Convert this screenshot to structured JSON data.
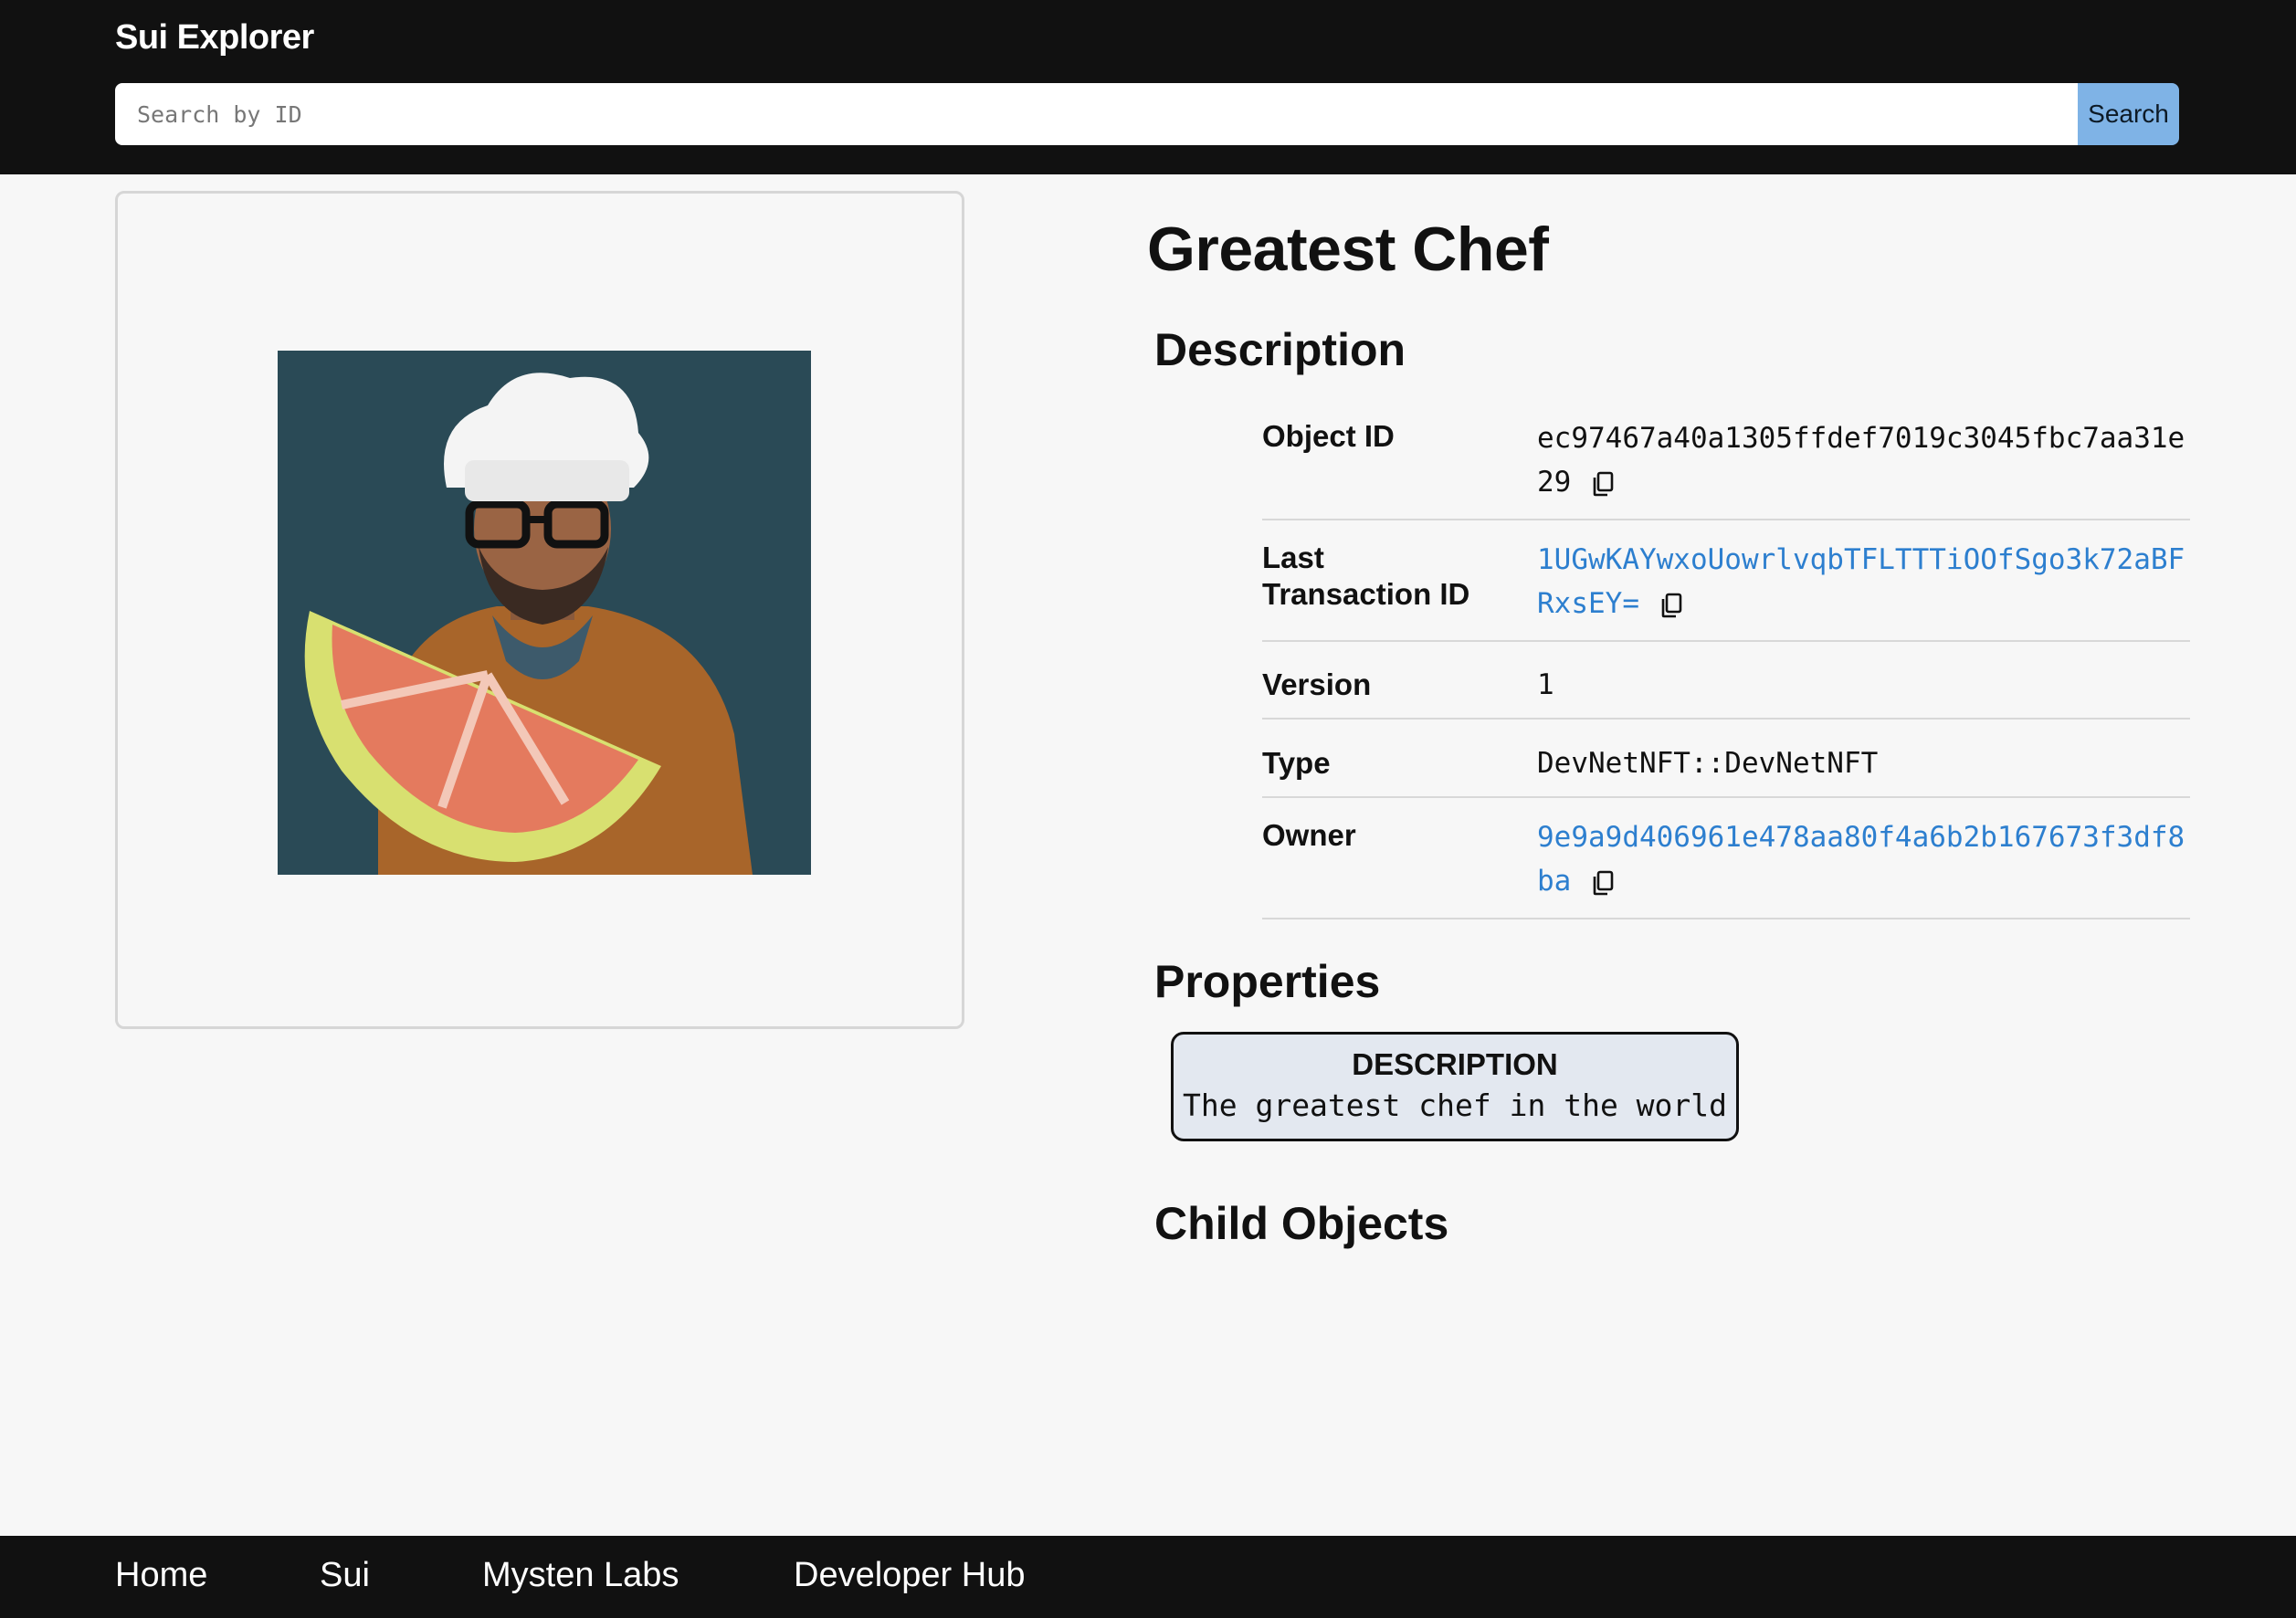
{
  "header": {
    "brand": "Sui Explorer",
    "search_placeholder": "Search by ID",
    "search_value": "",
    "search_button": "Search"
  },
  "object": {
    "title": "Greatest Chef",
    "image_alt": "Chef with grapefruit slice"
  },
  "description_section": {
    "heading": "Description",
    "rows": [
      {
        "label": "Object ID",
        "value": "ec97467a40a1305ffdef7019c3045fbc7aa31e29",
        "copyable": true,
        "link": false
      },
      {
        "label": "Last Transaction ID",
        "value": "1UGwKAYwxoUowrlvqbTFLTTTiOOfSgo3k72aBFRxsEY=",
        "copyable": true,
        "link": true
      },
      {
        "label": "Version",
        "value": "1",
        "copyable": false,
        "link": false
      },
      {
        "label": "Type",
        "value": "DevNetNFT::DevNetNFT",
        "copyable": false,
        "link": false
      },
      {
        "label": "Owner",
        "value": "9e9a9d406961e478aa80f4a6b2b167673f3df8ba",
        "copyable": true,
        "link": true
      }
    ]
  },
  "properties_section": {
    "heading": "Properties",
    "items": [
      {
        "key": "DESCRIPTION",
        "value": "The greatest chef in the world"
      }
    ]
  },
  "child_objects_section": {
    "heading": "Child Objects"
  },
  "footer": {
    "links": [
      "Home",
      "Sui",
      "Mysten Labs",
      "Developer Hub"
    ]
  },
  "colors": {
    "header_bg": "#111111",
    "search_button_bg": "#7fb3e6",
    "link": "#2d7fcf",
    "property_bg": "#e3e8f0",
    "image_bg": "#2a4a56"
  },
  "icons": [
    "copy-icon"
  ]
}
